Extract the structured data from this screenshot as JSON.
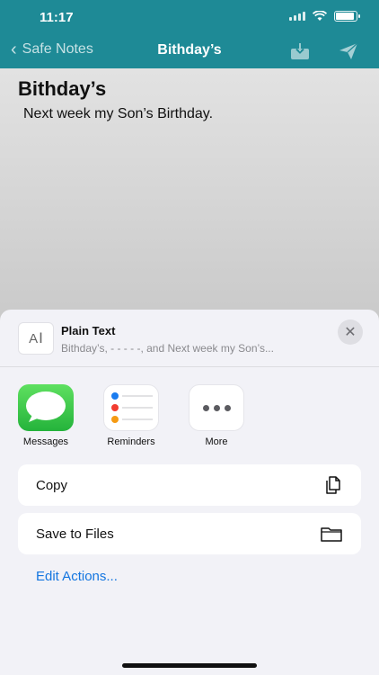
{
  "status_bar": {
    "time": "11:17"
  },
  "nav": {
    "back_label": "Safe Notes",
    "title": "Bithday’s",
    "download_icon": "download-tray-icon",
    "send_icon": "paper-plane-icon"
  },
  "note": {
    "title": "Bithday’s",
    "body": "Next week my Son’s Birthday."
  },
  "share_sheet": {
    "preview": {
      "thumb": "A",
      "title": "Plain Text",
      "subtitle": "Bithday’s, - - - - -, and Next week my Son’s..."
    },
    "apps": [
      {
        "label": "Messages",
        "icon": "messages-icon"
      },
      {
        "label": "Reminders",
        "icon": "reminders-icon"
      },
      {
        "label": "More",
        "icon": "more-icon"
      }
    ],
    "actions": [
      {
        "label": "Copy",
        "icon": "copy-icon"
      },
      {
        "label": "Save to Files",
        "icon": "folder-icon"
      }
    ],
    "edit_actions": "Edit Actions..."
  },
  "colors": {
    "nav_bar": "#1e8a96",
    "link_blue": "#1476e0",
    "messages_green": "#2fc24a"
  }
}
